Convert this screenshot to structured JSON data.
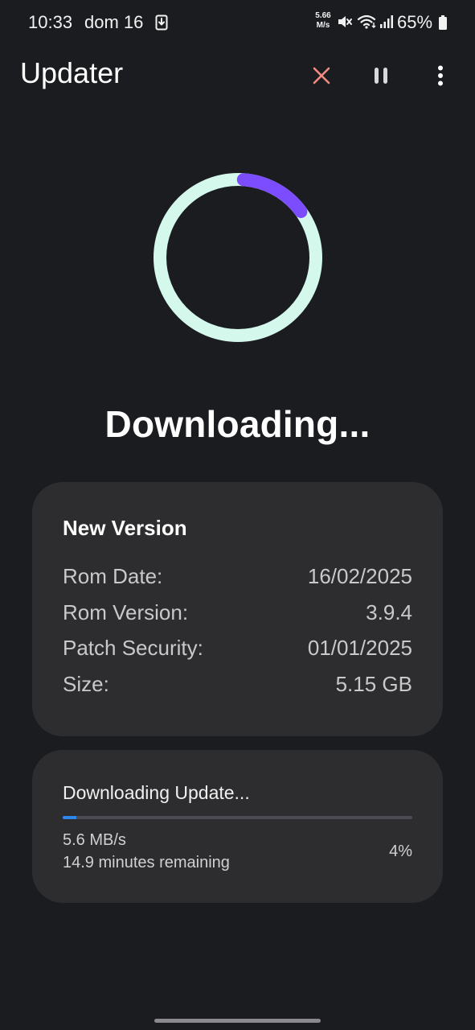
{
  "status_bar": {
    "time": "10:33",
    "date": "dom 16",
    "net_speed_value": "5.66",
    "net_speed_unit": "M/s",
    "battery": "65%",
    "icons": [
      "download-notification-icon",
      "mute-icon",
      "wifi-icon",
      "signal-icon",
      "battery-icon"
    ]
  },
  "app_bar": {
    "title": "Updater",
    "actions": [
      "close-icon",
      "pause-icon",
      "more-vert-icon"
    ]
  },
  "progress_ring": {
    "fraction": 0.04,
    "track_color": "#d5f8ec",
    "progress_color": "#7c4dff"
  },
  "heading": "Downloading...",
  "info_card": {
    "title": "New Version",
    "rows": [
      {
        "label": "Rom Date:",
        "value": "16/02/2025"
      },
      {
        "label": "Rom Version:",
        "value": "3.9.4"
      },
      {
        "label": "Patch Security:",
        "value": "01/01/2025"
      },
      {
        "label": "Size:",
        "value": "5.15 GB"
      }
    ]
  },
  "download_card": {
    "title": "Downloading Update...",
    "speed": "5.6 MB/s",
    "remaining": "14.9 minutes remaining",
    "percent_label": "4%",
    "progress_fraction": 0.04,
    "bar_color": "#2f86e8"
  },
  "colors": {
    "background": "#1b1c20",
    "card": "#2d2d2f",
    "close_accent": "#f28b82"
  }
}
